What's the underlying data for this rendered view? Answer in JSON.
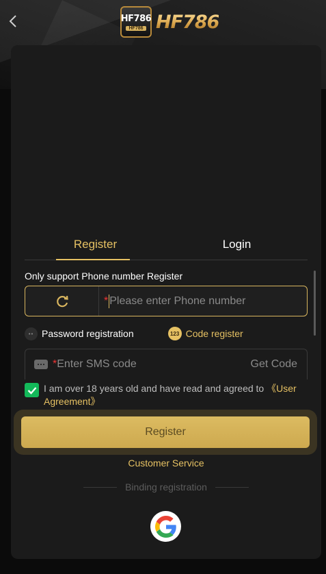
{
  "header": {
    "logo_badge_main": "HF786",
    "logo_badge_sub": "HF786",
    "logo_text": "HF786"
  },
  "tabs": [
    {
      "label": "Register",
      "active": true
    },
    {
      "label": "Login",
      "active": false
    }
  ],
  "form": {
    "hint": "Only support Phone number Register",
    "phone": {
      "required_mark": "*",
      "placeholder": "Please enter Phone number",
      "value": ""
    },
    "options": {
      "password_registration": "Password registration",
      "code_register": "Code register",
      "code_icon_text": "123"
    },
    "sms": {
      "required_mark": "*",
      "placeholder": "Enter SMS code",
      "value": "",
      "get_code": "Get Code"
    },
    "agreement": {
      "checked": true,
      "text": "I am over 18 years old and have read and agreed to ",
      "link": "《User Agreement》"
    },
    "register_button": "Register"
  },
  "customer_service": "Customer Service",
  "binding_label": "Binding registration",
  "social": [
    {
      "icon": "google-icon"
    }
  ],
  "colors": {
    "accent": "#e6c163",
    "button": "#d4b155",
    "checkbox": "#13b95a",
    "card": "#1b1b1b"
  }
}
